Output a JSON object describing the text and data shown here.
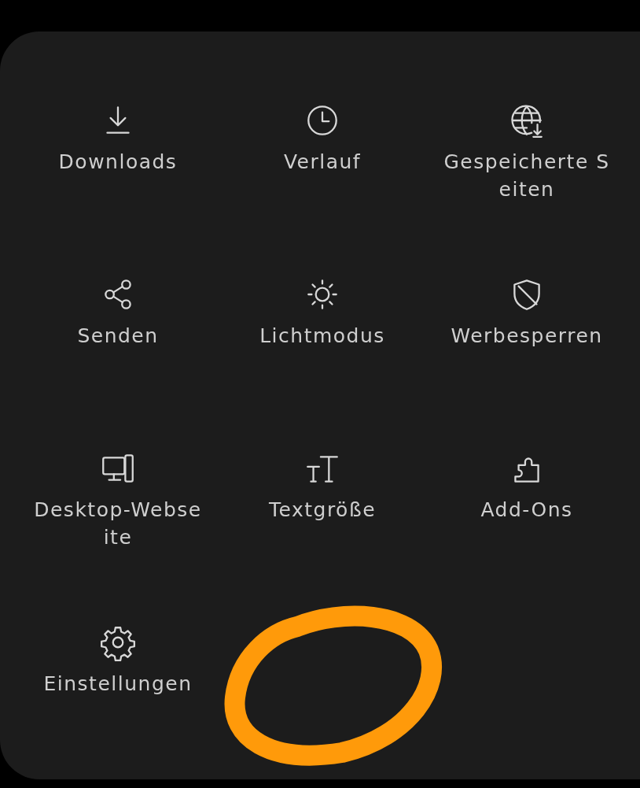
{
  "menu": {
    "items": [
      {
        "label": "Downloads"
      },
      {
        "label": "Verlauf"
      },
      {
        "label": "Gespeicherte Seiten"
      },
      {
        "label": "Senden"
      },
      {
        "label": "Lichtmodus"
      },
      {
        "label": "Werbesperren"
      },
      {
        "label": "Desktop-Webseite"
      },
      {
        "label": "Textgröße"
      },
      {
        "label": "Add-Ons"
      },
      {
        "label": "Einstellungen"
      }
    ]
  }
}
